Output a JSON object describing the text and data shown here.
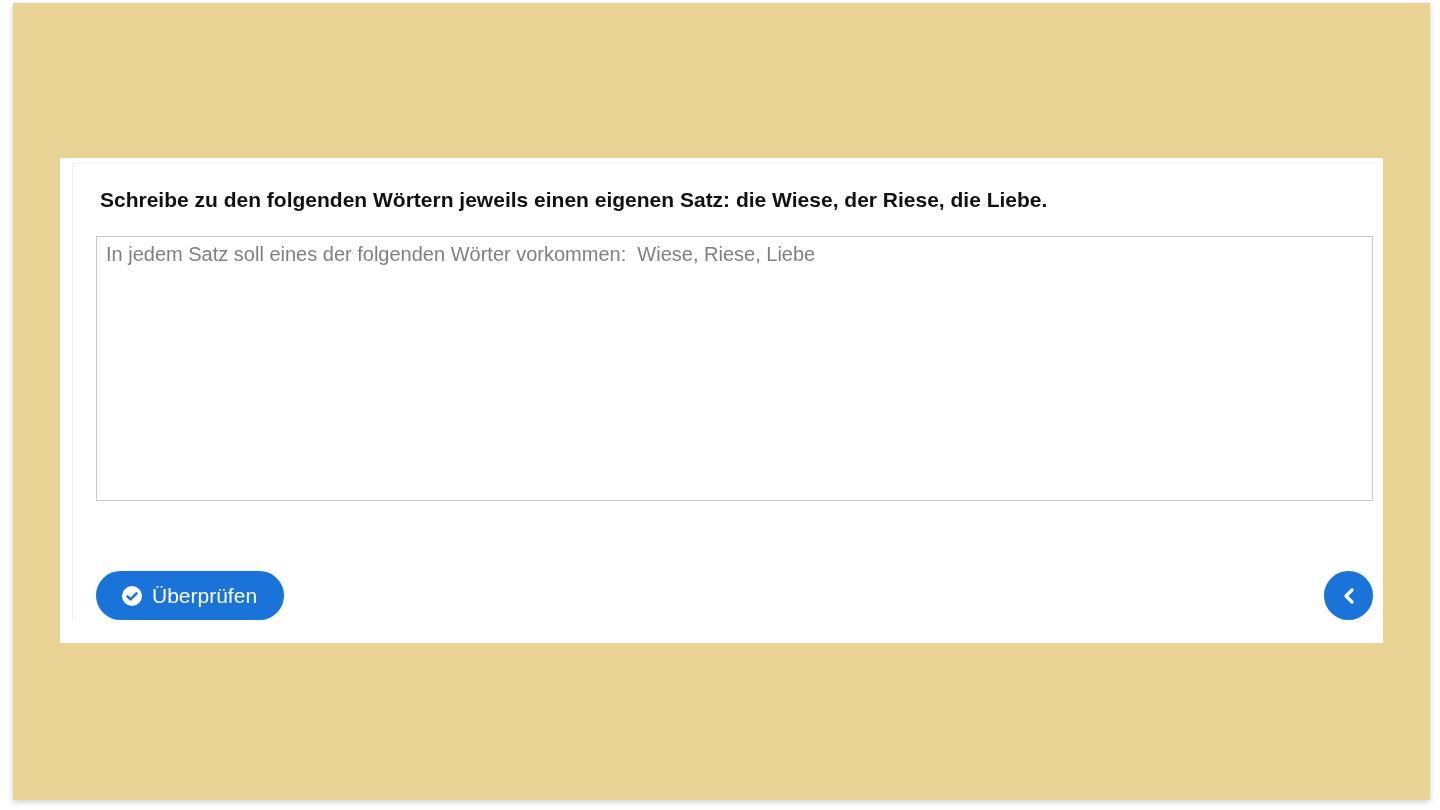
{
  "task": {
    "question": "Schreibe zu den folgenden Wörtern jeweils einen eigenen Satz: die Wiese, der Riese, die Liebe.",
    "answer": {
      "placeholder": "In jedem Satz soll eines der folgenden Wörter vorkommen:  Wiese, Riese, Liebe"
    },
    "check_button": {
      "label": "Überprüfen"
    }
  }
}
